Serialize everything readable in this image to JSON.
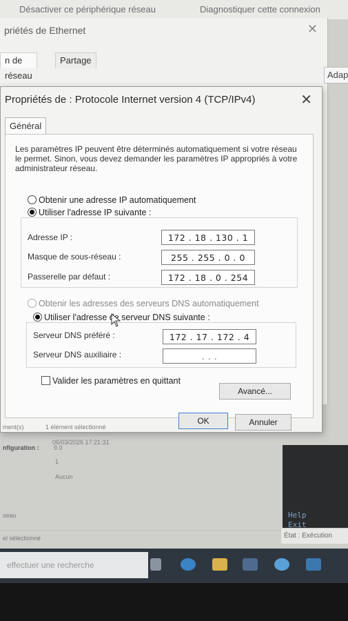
{
  "top_strip": {
    "left_text": "Désactiver ce périphérique réseau",
    "right_text": "Diagnostiquer cette connexion"
  },
  "ethernet_window": {
    "title": "priétés de Ethernet",
    "tabs": [
      {
        "label": "n de réseau"
      },
      {
        "label": "Partage"
      }
    ],
    "adapt_button": "Adapt"
  },
  "dialog": {
    "title": "Propriétés de : Protocole Internet version 4 (TCP/IPv4)",
    "close_glyph": "✕",
    "tab": "Général",
    "description": "Les paramètres IP peuvent être déterminés automatiquement si votre réseau le permet. Sinon, vous devez demander les paramètres IP appropriés à votre administrateur réseau.",
    "ip_auto_label": "Obtenir une adresse IP automatiquement",
    "ip_manual_label": "Utiliser l'adresse IP suivante :",
    "ip_mode": "manual",
    "ip_address_label": "Adresse IP :",
    "ip_address_value": "172 . 18 . 130 . 1",
    "subnet_label": "Masque de sous-réseau :",
    "subnet_value": "255 . 255 . 0 . 0",
    "gateway_label": "Passerelle par défaut :",
    "gateway_value": "172 . 18 . 0 . 254",
    "dns_auto_label": "Obtenir les adresses des serveurs DNS automatiquement",
    "dns_manual_label": "Utiliser l'adresse de serveur DNS suivante :",
    "dns_mode": "manual",
    "dns_preferred_label": "Serveur DNS préféré :",
    "dns_preferred_value": "172 . 17 . 172 . 4",
    "dns_alternate_label": "Serveur DNS auxiliaire :",
    "dns_alternate_value": ". . .",
    "validate_label": "Valider les paramètres en quittant",
    "validate_checked": false,
    "advanced_button": "Avancé...",
    "ok_button": "OK",
    "cancel_button": "Annuler"
  },
  "explorer": {
    "items_label": "ment(s)",
    "selected_text": "1 élément sélectionné",
    "date_text": "06/03/2026 17:21:31",
    "config_label": "nfiguration :",
    "config_value": "9.0",
    "value_one": "1",
    "value_none": "Aucun",
    "network_text": "seau",
    "status_selected": "el sélectionné",
    "etat": "État : Exécution"
  },
  "terminal": {
    "line1": "Help",
    "line2": "Exit"
  },
  "taskbar": {
    "search_placeholder": "effectuer une recherche"
  },
  "colors": {
    "dialog_bg": "#f3f3f1",
    "default_button_border": "#3b7fd1",
    "taskbar": "#2e3640"
  }
}
